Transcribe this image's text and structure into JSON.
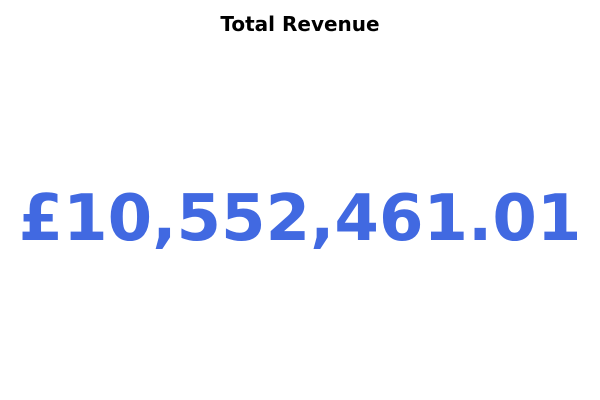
{
  "chart_data": {
    "type": "table",
    "title": "Total Revenue",
    "value": 10552461.01,
    "value_label": "£10,552,461.01",
    "value_color": "#4169e1"
  }
}
